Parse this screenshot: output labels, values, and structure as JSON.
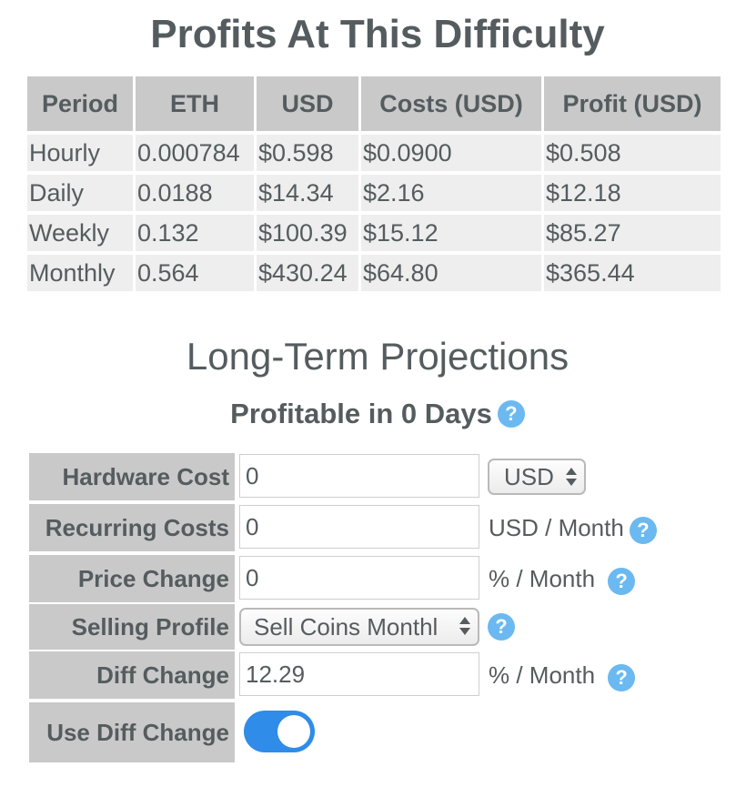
{
  "profits": {
    "title": "Profits At This Difficulty",
    "headers": [
      "Period",
      "ETH",
      "USD",
      "Costs (USD)",
      "Profit (USD)"
    ],
    "rows": [
      [
        "Hourly",
        "0.000784",
        "$0.598",
        "$0.0900",
        "$0.508"
      ],
      [
        "Daily",
        "0.0188",
        "$14.34",
        "$2.16",
        "$12.18"
      ],
      [
        "Weekly",
        "0.132",
        "$100.39",
        "$15.12",
        "$85.27"
      ],
      [
        "Monthly",
        "0.564",
        "$430.24",
        "$64.80",
        "$365.44"
      ]
    ]
  },
  "projections": {
    "title": "Long-Term Projections",
    "profitable_prefix": "Profitable in ",
    "profitable_value": "0 Days",
    "help_glyph": "?"
  },
  "form": {
    "hardware_cost": {
      "label": "Hardware Cost",
      "value": "0",
      "currency": "USD"
    },
    "recurring_costs": {
      "label": "Recurring Costs",
      "value": "0",
      "unit": "USD / Month"
    },
    "price_change": {
      "label": "Price Change",
      "value": "0",
      "unit": "% / Month"
    },
    "selling_profile": {
      "label": "Selling Profile",
      "value": "Sell Coins Monthl"
    },
    "diff_change": {
      "label": "Diff Change",
      "value": "12.29",
      "unit": "% / Month"
    },
    "use_diff_change": {
      "label": "Use Diff Change",
      "enabled": true
    }
  },
  "colors": {
    "text": "#555c5f",
    "header_bg": "#c9c9c9",
    "cell_bg": "#eeeeee",
    "help": "#6bb9f0",
    "toggle_on": "#2f8ce8"
  }
}
